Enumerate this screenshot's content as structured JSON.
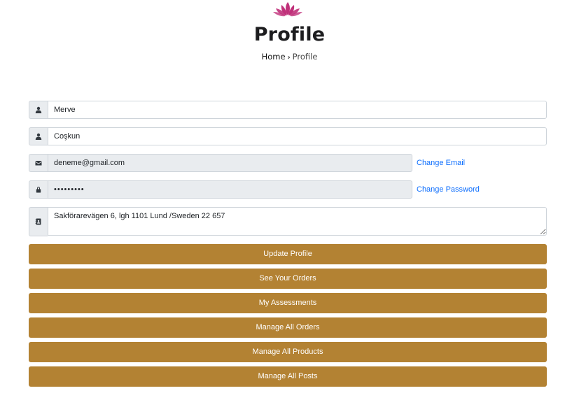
{
  "header": {
    "logo_icon": "lotus-logo-icon",
    "logo_color": "#c0317a",
    "title": "Profile",
    "breadcrumb": {
      "home": "Home",
      "separator": "›",
      "current": "Profile"
    }
  },
  "form": {
    "first_name": {
      "icon": "user-icon",
      "value": "Merve"
    },
    "last_name": {
      "icon": "user-icon",
      "value": "Coşkun"
    },
    "email": {
      "icon": "envelope-icon",
      "value": "deneme@gmail.com",
      "link": "Change Email"
    },
    "password": {
      "icon": "lock-icon",
      "value": "*********",
      "link": "Change Password"
    },
    "address": {
      "icon": "address-book-icon",
      "value": "Sakförarevägen 6, lgh 1101 Lund /Sweden 22 657"
    }
  },
  "buttons": {
    "update_profile": "Update Profile",
    "see_orders": "See Your Orders",
    "my_assessments": "My Assessments",
    "manage_orders": "Manage All Orders",
    "manage_products": "Manage All Products",
    "manage_posts": "Manage All Posts"
  },
  "colors": {
    "button_bg": "#b38233",
    "link": "#0d6efd",
    "readonly_bg": "#e9ecef"
  }
}
